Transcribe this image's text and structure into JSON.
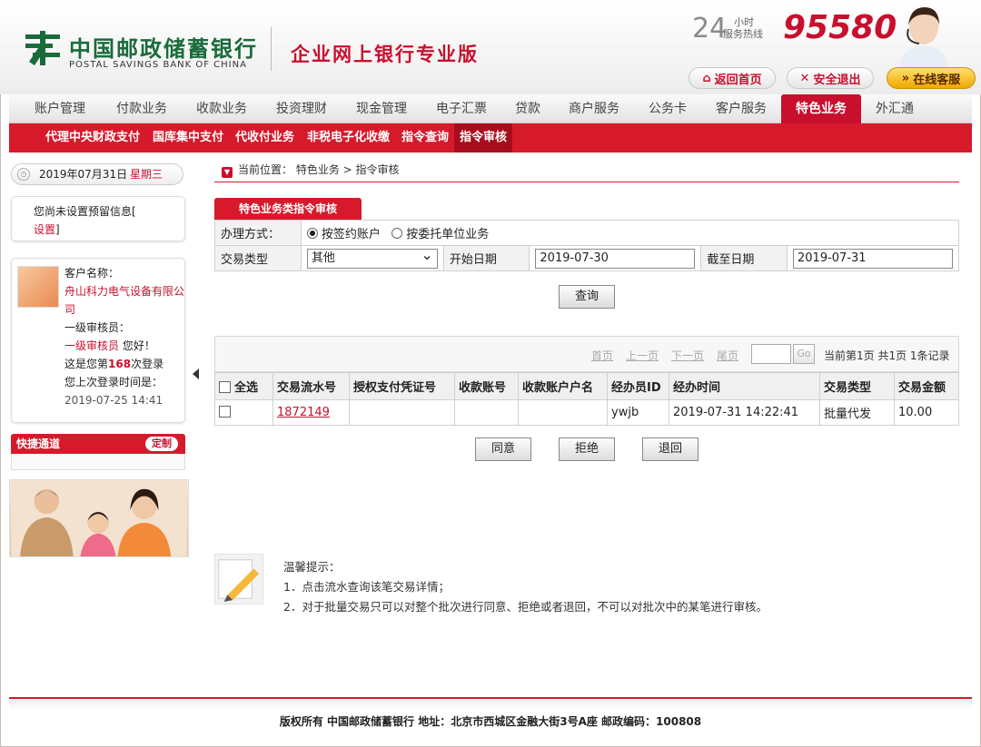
{
  "brand": {
    "name_cn": "中国邮政储蓄银行",
    "name_en": "POSTAL SAVINGS BANK OF CHINA",
    "edition": "企业网上银行专业版",
    "brand_red": "#c8102e",
    "brand_green": "#1a6b3a"
  },
  "hotline": {
    "hours": "24",
    "hours_label": "小时",
    "service_label": "服务热线",
    "number": "95580"
  },
  "header_buttons": {
    "home": "返回首页",
    "exit": "安全退出",
    "online": "在线客服"
  },
  "main_nav": [
    "账户管理",
    "付款业务",
    "收款业务",
    "投资理财",
    "现金管理",
    "电子汇票",
    "贷款",
    "商户服务",
    "公务卡",
    "客户服务",
    "特色业务",
    "外汇通"
  ],
  "main_nav_active": "特色业务",
  "sub_nav": [
    "代理中央财政支付",
    "国库集中支付",
    "代收付业务",
    "非税电子化收缴",
    "指令查询",
    "指令审核"
  ],
  "sub_nav_active": "指令审核",
  "sidebar": {
    "date": "2019年07月31日",
    "weekday": "星期三",
    "notice_text": "您尚未设置预留信息[",
    "notice_link": "设置",
    "notice_end": "]",
    "customer_label": "客户名称：",
    "customer_name": "舟山科力电气设备有限公司",
    "auditor_label": "一级审核员：",
    "auditor_name": "一级审核员",
    "greeting": "您好！",
    "login_prefix": "这是您第",
    "login_count": "168",
    "login_suffix": "次登录",
    "last_login_label": "您上次登录时间是：",
    "last_login_time": "2019-07-25 14:41",
    "quick_title": "快捷通道",
    "quick_custom": "定制"
  },
  "breadcrumb": {
    "label": "当前位置：",
    "path": "特色业务 > 指令审核"
  },
  "section_title": "特色业务类指令审核",
  "form": {
    "method_label": "办理方式：",
    "method_options": [
      "按签约账户",
      "按委托单位业务"
    ],
    "method_selected": 0,
    "type_label": "交易类型",
    "type_value": "其他",
    "start_label": "开始日期",
    "start_value": "2019-07-30",
    "end_label": "截至日期",
    "end_value": "2019-07-31",
    "query_button": "查询"
  },
  "pager": {
    "first": "首页",
    "prev": "上一页",
    "next": "下一页",
    "last": "尾页",
    "go": "Go",
    "info": "当前第1页 共1页 1条记录"
  },
  "table": {
    "select_all": "全选",
    "columns": [
      "交易流水号",
      "授权支付凭证号",
      "收款账号",
      "收款账户户名",
      "经办员ID",
      "经办时间",
      "交易类型",
      "交易金额"
    ],
    "rows": [
      {
        "serial": "1872149",
        "voucher": "",
        "account": "",
        "account_name": "",
        "operator": "ywjb",
        "time": "2019-07-31 14:22:41",
        "type": "批量代发",
        "amount": "10.00"
      }
    ]
  },
  "actions": {
    "agree": "同意",
    "reject": "拒绝",
    "return": "退回"
  },
  "tips": {
    "title": "温馨提示：",
    "items": [
      "1．点击流水查询该笔交易详情；",
      "2．对于批量交易只可以对整个批次进行同意、拒绝或者退回，不可以对批次中的某笔进行审核。"
    ]
  },
  "footer": "版权所有  中国邮政储蓄银行  地址：北京市西城区金融大街3号A座  邮政编码：100808"
}
